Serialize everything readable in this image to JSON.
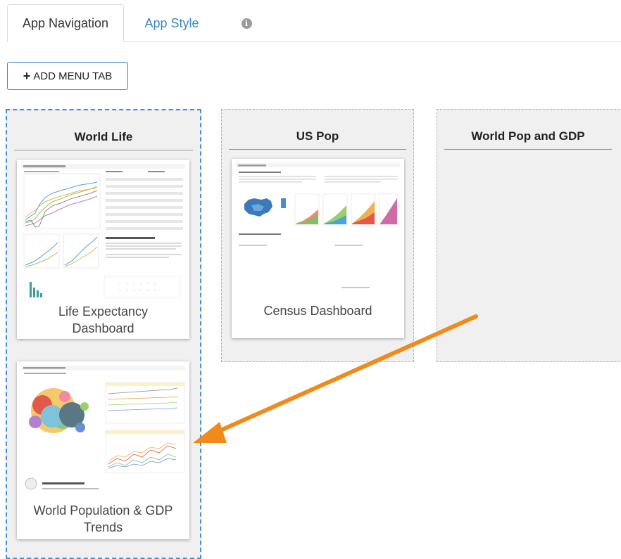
{
  "tabs": {
    "app_navigation": "App Navigation",
    "app_style": "App Style",
    "info_glyph": "i"
  },
  "add_menu_tab_label": "ADD MENU TAB",
  "columns": [
    {
      "title": "World Life",
      "cards": [
        {
          "label": "Life Expectancy Dashboard"
        },
        {
          "label": "World Population & GDP Trends"
        }
      ]
    },
    {
      "title": "US Pop",
      "cards": [
        {
          "label": "Census Dashboard"
        }
      ]
    },
    {
      "title": "World Pop and GDP",
      "cards": []
    }
  ],
  "colors": {
    "accent": "#3a87c8",
    "arrow": "#f08a1a",
    "selected_border": "#4a8fd0"
  }
}
